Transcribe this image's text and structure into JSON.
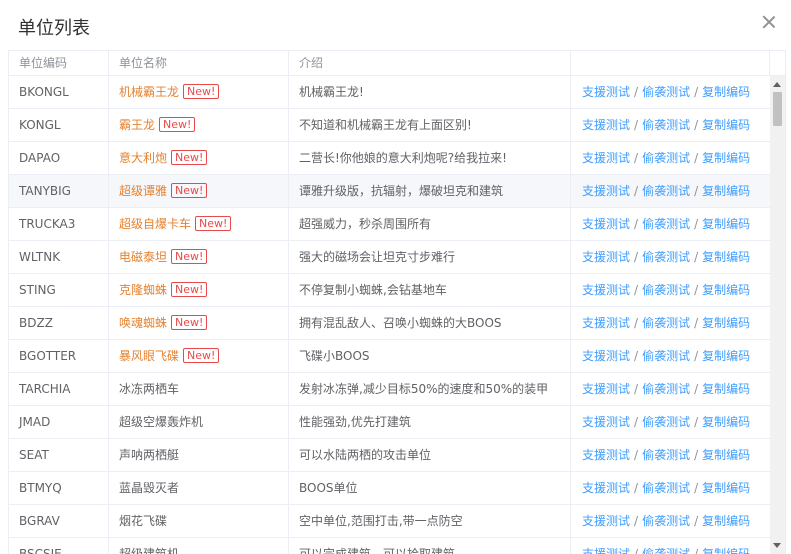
{
  "dialog": {
    "title": "单位列表"
  },
  "columns": [
    "单位编码",
    "单位名称",
    "介绍",
    ""
  ],
  "actions": {
    "a1": "支援测试",
    "a2": "偷袭测试",
    "a3": "复制编码",
    "sep": "/"
  },
  "badge_text": "New!",
  "rows": [
    {
      "code": "BKONGL",
      "name": "机械霸王龙",
      "intro": "机械霸王龙!"
    },
    {
      "code": "KONGL",
      "name": "霸王龙",
      "intro": "不知道和机械霸王龙有上面区别!"
    },
    {
      "code": "DAPAO",
      "name": "意大利炮",
      "intro": "二营长!你他娘的意大利炮呢?给我拉来!"
    },
    {
      "code": "TANYBIG",
      "name": "超级谭雅",
      "intro": "谭雅升级版，抗辐射，爆破坦克和建筑"
    },
    {
      "code": "TRUCKA3",
      "name": "超级自爆卡车",
      "intro": "超强威力，秒杀周围所有"
    },
    {
      "code": "WLTNK",
      "name": "电磁泰坦",
      "intro": "强大的磁场会让坦克寸步难行"
    },
    {
      "code": "STING",
      "name": "克隆蜘蛛",
      "intro": "不停复制小蜘蛛,会钻基地车"
    },
    {
      "code": "BDZZ",
      "name": "唤魂蜘蛛",
      "intro": "拥有混乱敌人、召唤小蜘蛛的大BOOS"
    },
    {
      "code": "BGOTTER",
      "name": "暴风眼飞碟",
      "intro": "飞碟小BOOS"
    },
    {
      "code": "TARCHIA",
      "name": "冰冻两栖车",
      "intro": "发射冰冻弹,减少目标50%的速度和50%的装甲"
    },
    {
      "code": "JMAD",
      "name": "超级空爆轰炸机",
      "intro": "性能强劲,优先打建筑"
    },
    {
      "code": "SEAT",
      "name": "声呐两栖艇",
      "intro": "可以水陆两栖的攻击单位"
    },
    {
      "code": "BTMYQ",
      "name": "蓝晶毁灭者",
      "intro": "BOOS单位"
    },
    {
      "code": "BGRAV",
      "name": "烟花飞碟",
      "intro": "空中单位,范围打击,带一点防空"
    },
    {
      "code": "BSCSIE",
      "name": "超级建筑机",
      "intro": "可以完成建筑，可以拾取建筑"
    }
  ]
}
